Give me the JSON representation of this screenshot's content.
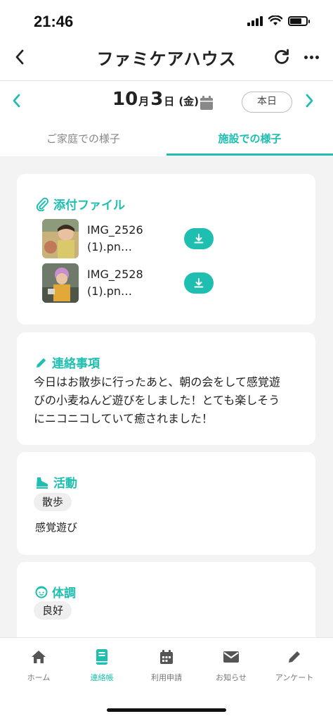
{
  "status": {
    "time": "21:46"
  },
  "header": {
    "title": "ファミケアハウス"
  },
  "date_bar": {
    "month_num": "10",
    "month_suffix": "月",
    "day_num": "3",
    "day_suffix": "日",
    "weekday": "(金)",
    "today_label": "本日"
  },
  "tabs": [
    {
      "label": "ご家庭での様子",
      "active": false
    },
    {
      "label": "施設での様子",
      "active": true
    }
  ],
  "attachments": {
    "title": "添付ファイル",
    "files": [
      {
        "name_line1": "IMG_2526",
        "name_line2": "(1).pn…"
      },
      {
        "name_line1": "IMG_2528",
        "name_line2": "(1).pn…"
      }
    ]
  },
  "notice": {
    "title": "連絡事項",
    "line1": "今日はお散歩に行ったあと、朝の会をして感覚遊",
    "line2": "びの小麦ねんど遊びをしました！とても楽しそう",
    "line3": "にニコニコしていて癒されました！"
  },
  "activity": {
    "title": "活動",
    "tag": "散歩",
    "detail": "感覚遊び"
  },
  "condition": {
    "title": "体調",
    "tag": "良好"
  },
  "bottom_nav": [
    {
      "label": "ホーム",
      "icon": "home-icon"
    },
    {
      "label": "連絡帳",
      "icon": "notebook-icon",
      "active": true
    },
    {
      "label": "利用申請",
      "icon": "calendar-icon"
    },
    {
      "label": "お知らせ",
      "icon": "mail-icon"
    },
    {
      "label": "アンケート",
      "icon": "pencil-icon"
    }
  ],
  "colors": {
    "accent": "#1ebfb0",
    "background": "#f3f3f4"
  }
}
